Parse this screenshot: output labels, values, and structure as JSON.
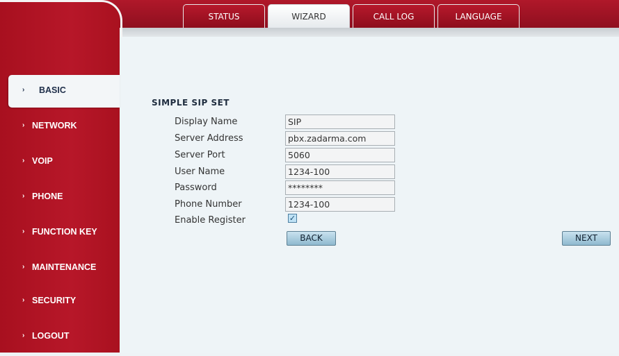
{
  "tabs": [
    {
      "label": "STATUS",
      "active": false
    },
    {
      "label": "WIZARD",
      "active": true
    },
    {
      "label": "CALL LOG",
      "active": false
    },
    {
      "label": "LANGUAGE",
      "active": false
    }
  ],
  "nav": {
    "arrow_glyph": "›",
    "items": [
      {
        "label": "BASIC",
        "active": true
      },
      {
        "label": "NETWORK"
      },
      {
        "label": "VOIP"
      },
      {
        "label": "PHONE"
      },
      {
        "label": "FUNCTION KEY"
      },
      {
        "label": "MAINTENANCE"
      },
      {
        "label": "SECURITY"
      },
      {
        "label": "LOGOUT"
      }
    ]
  },
  "form": {
    "title": "SIMPLE SIP SET",
    "fields": {
      "display_name": {
        "label": "Display Name",
        "value": "SIP"
      },
      "server_address": {
        "label": "Server Address",
        "value": "pbx.zadarma.com"
      },
      "server_port": {
        "label": "Server Port",
        "value": "5060"
      },
      "user_name": {
        "label": "User Name",
        "value": "1234-100"
      },
      "password": {
        "label": "Password",
        "value": "********"
      },
      "phone_number": {
        "label": "Phone Number",
        "value": "1234-100"
      }
    },
    "enable_register": {
      "label": "Enable Register",
      "checked": true,
      "check_glyph": "✓"
    },
    "back_label": "BACK",
    "next_label": "NEXT"
  },
  "colors": {
    "brand_red": "#b0182a",
    "content_bg": "#eef4f7",
    "button_blue": "#a9cfe2"
  }
}
